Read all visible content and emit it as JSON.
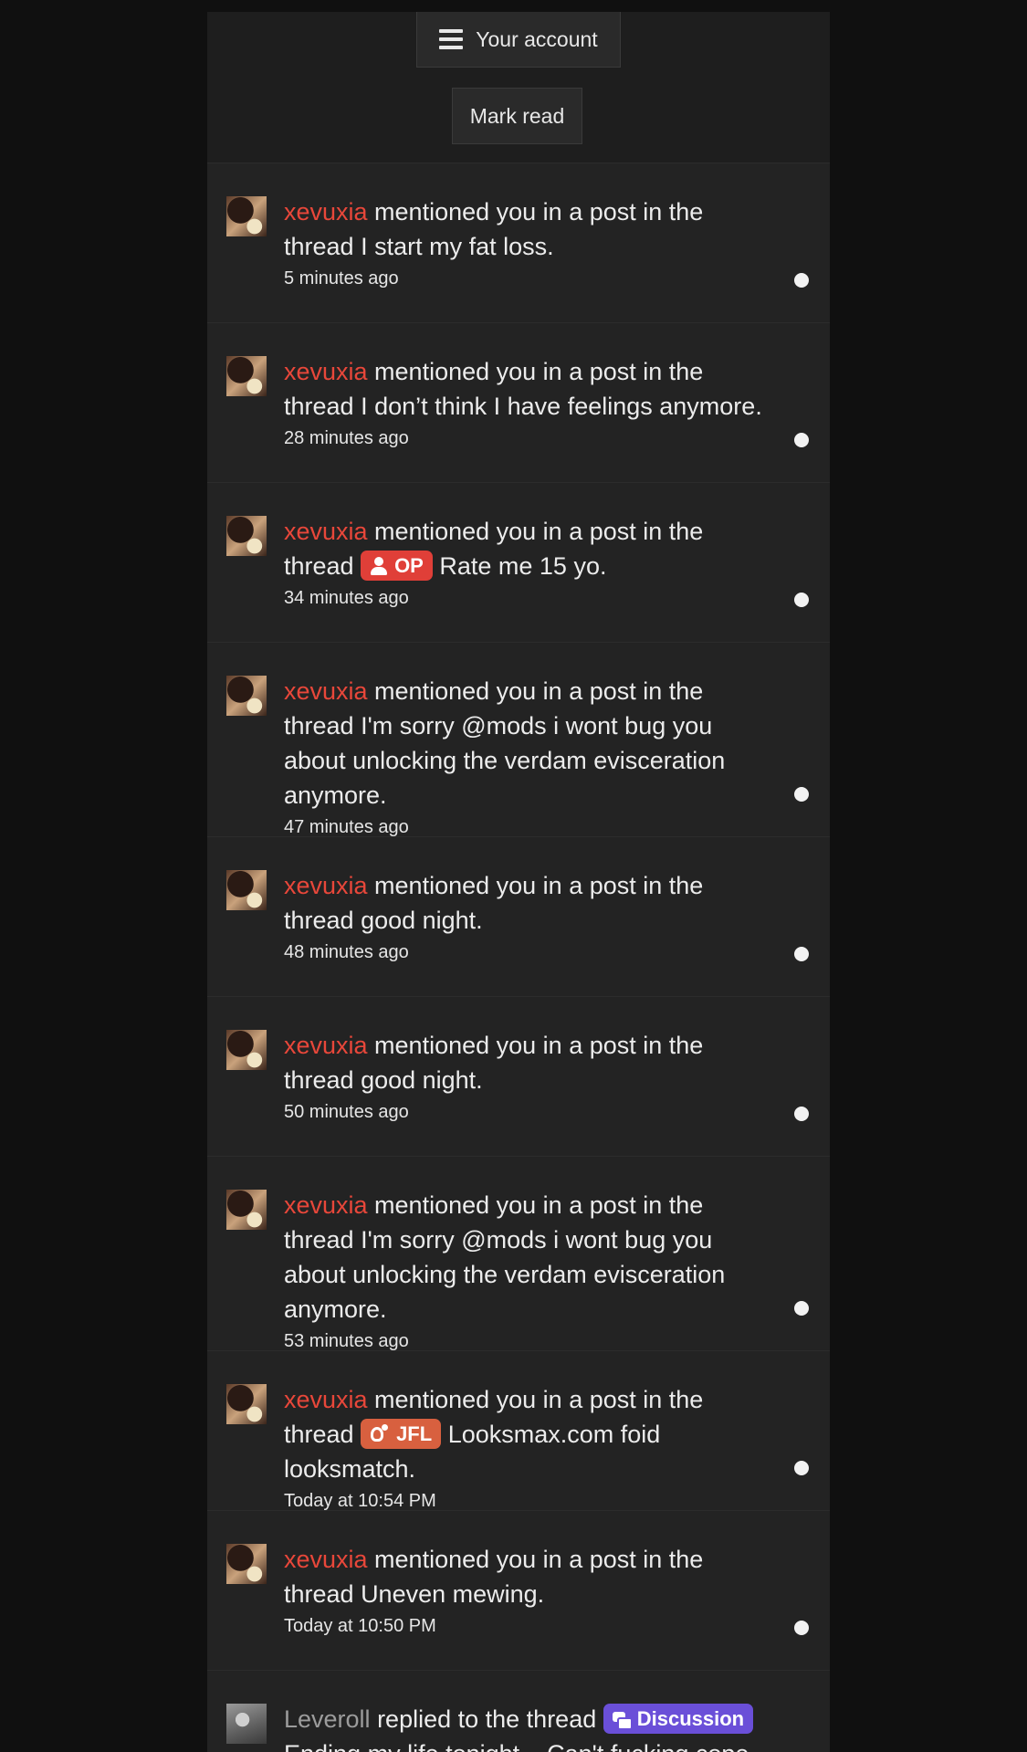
{
  "header": {
    "account_label": "Your account",
    "mark_read_label": "Mark read"
  },
  "alerts": [
    {
      "user": "xevuxia",
      "action": " mentioned you in a post in the thread ",
      "prefix": "",
      "title": "I start my fat loss.",
      "time": "5 minutes ago"
    },
    {
      "user": "xevuxia",
      "action": " mentioned you in a post in the thread ",
      "prefix": "",
      "title": "I don’t think I have feelings anymore.",
      "time": "28 minutes ago"
    },
    {
      "user": "xevuxia",
      "action": " mentioned you in a post in the thread ",
      "prefix": "OP",
      "title": "Rate me 15 yo.",
      "time": "34 minutes ago"
    },
    {
      "user": "xevuxia",
      "action": " mentioned you in a post in the thread ",
      "prefix": "",
      "title": "I'm sorry @mods i wont bug you about unlocking the verdam evisceration anymore.",
      "time": "47 minutes ago"
    },
    {
      "user": "xevuxia",
      "action": " mentioned you in a post in the thread ",
      "prefix": "",
      "title": "good night.",
      "time": "48 minutes ago"
    },
    {
      "user": "xevuxia",
      "action": " mentioned you in a post in the thread ",
      "prefix": "",
      "title": "good night.",
      "time": "50 minutes ago"
    },
    {
      "user": "xevuxia",
      "action": " mentioned you in a post in the thread ",
      "prefix": "",
      "title": "I'm sorry @mods i wont bug you about unlocking the verdam evisceration anymore.",
      "time": "53 minutes ago"
    },
    {
      "user": "xevuxia",
      "action": " mentioned you in a post in the thread ",
      "prefix": "JFL",
      "title": "Looksmax.com foid looksmatch.",
      "time": "Today at 10:54 PM"
    },
    {
      "user": "xevuxia",
      "action": " mentioned you in a post in the thread ",
      "prefix": "",
      "title": "Uneven mewing.",
      "time": "Today at 10:50 PM"
    },
    {
      "user": "Leveroll",
      "action": " replied to the thread ",
      "prefix": "Discussion",
      "title": "Ending my life tonight... Can't fucking cope",
      "time": ""
    }
  ],
  "colors": {
    "page_bg": "#101010",
    "panel_bg": "#232323",
    "username_red": "#e8473a",
    "prefix_op": "#e03f38",
    "prefix_jfl": "#d8603f",
    "prefix_discussion": "#6a4fd8"
  },
  "icons": {
    "menu": "hamburger-icon",
    "op_prefix": "user-icon",
    "jfl_prefix": "jfl-icon",
    "discussion_prefix": "chat-icon",
    "unread": "unread-dot"
  }
}
